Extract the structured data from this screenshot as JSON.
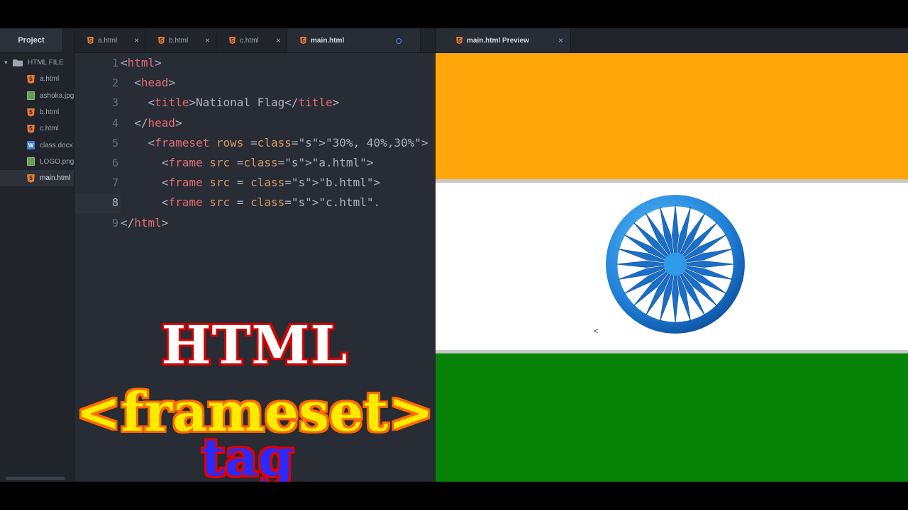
{
  "sidebar": {
    "tab_label": "Project",
    "root_folder": "HTML FILE",
    "files": [
      {
        "name": "a.html",
        "icon": "html5-icon"
      },
      {
        "name": "ashoka.jpg",
        "icon": "image-icon"
      },
      {
        "name": "b.html",
        "icon": "html5-icon"
      },
      {
        "name": "c.html",
        "icon": "html5-icon"
      },
      {
        "name": "class.docx",
        "icon": "word-doc-icon"
      },
      {
        "name": "LOGO.png",
        "icon": "image-icon"
      },
      {
        "name": "main.html",
        "icon": "html5-icon",
        "selected": true
      }
    ]
  },
  "editor": {
    "tabs": [
      {
        "label": "a.html"
      },
      {
        "label": "b.html"
      },
      {
        "label": "c.html"
      },
      {
        "label": "main.html",
        "active": true,
        "modified": true
      }
    ],
    "current_line": 8,
    "lines": [
      "<html>",
      "  <head>",
      "    <title>National Flag</title>",
      "  </head>",
      "    <frameset rows =\"30%, 40%,30%\">",
      "      <frame src =\"a.html\">",
      "      <frame src = \"b.html\">",
      "      <frame src = \"c.html\".",
      "</html>"
    ]
  },
  "overlay": {
    "line1": "HTML",
    "line2": "<frameset>",
    "line3": "tag"
  },
  "preview": {
    "tab_label": "main.html Preview",
    "stray_text": "<",
    "colors": {
      "saffron": "#ffa60a",
      "white": "#ffffff",
      "green": "#078407",
      "chakra": "#1f7fd6"
    }
  }
}
